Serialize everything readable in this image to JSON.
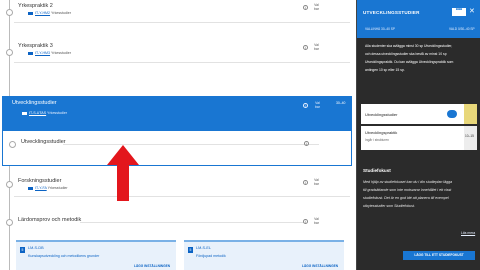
{
  "main": {
    "courses": [
      {
        "title": "Yrkespraktik 2",
        "code": "IT-Y-HM2",
        "level": "Yrkesstudier",
        "tag1": "Val",
        "tag2": "bar",
        "tag3": "Inleder"
      },
      {
        "title": "Yrkespraktik 3",
        "code": "IT-Y-HM3",
        "level": "Yrkesstudier",
        "tag1": "Val",
        "tag2": "bar",
        "tag3": "Inleder"
      }
    ],
    "selected": {
      "title": "Utvecklingsstudier",
      "code": "IT-S-UTAS",
      "level": "Yrkesstudier",
      "tag1": "Val",
      "tag2": "bar",
      "credits": "30–40",
      "tag3": "Inleder"
    },
    "sub_item": {
      "title": "Utvecklingsstudier"
    },
    "research": {
      "title": "Forskningsstudier",
      "code": "IT-Y-FA",
      "level": "Yrkesstudier",
      "tag1": "Val",
      "tag2": "bar",
      "tag3": "Inleder"
    },
    "methods": {
      "title": "Lärdomsprov och metodik"
    },
    "cards": [
      {
        "num": "5",
        "code": "LM-S-DB",
        "name": "Kunskapsutveckling och metodikens grunder",
        "action": "LÄGG INSTÄLLNINGEN"
      },
      {
        "num": "5",
        "code": "LM-S-EL",
        "name": "Fördjupad metodik",
        "action": "LÄGG INSTÄLLNINGEN"
      }
    ],
    "info_glyph": "i",
    "more_glyph": "•••"
  },
  "sidebar": {
    "title": "UTVECKLINGSSTUDIER",
    "close_glyph": "✕",
    "header_lines": [
      "VALLINHÄ 30–40 SP",
      "VALD 0/30–40 SP"
    ],
    "description": [
      "Alla studenter ska avlägga minst 30 sp Utvecklingsstudier,",
      "och dessa utvecklingsstudier ska bestå av minst 10 sp",
      "Utvecklingspraktik. Du kan avlägga Utvecklingspraktik som",
      "antingen 10 sp eller 15 sp."
    ],
    "items": [
      {
        "label": "Utvecklingsstudier",
        "credits": ""
      },
      {
        "label": "Utvecklingspraktik",
        "sublabel": "Ingår i strukturen",
        "credits": "10–15"
      }
    ],
    "section_heading": "Studiefokust",
    "section_text": [
      "Med hjälp av studiefokuset kan du i din studieplan lägga",
      "till gradsättande som inte motsvarar innehållet i ett visst",
      "studiefokust. Det är en god idé att planera till exempel",
      "utbytesstudier som Studiefokust."
    ],
    "more_link": "Läs mera",
    "add_button": "LÄGG TILL ETT STUDIEFOKUST",
    "colors": {
      "accent": "#1976d2",
      "yellow": "#e8d77a",
      "panel": "#2b2b2b"
    }
  }
}
